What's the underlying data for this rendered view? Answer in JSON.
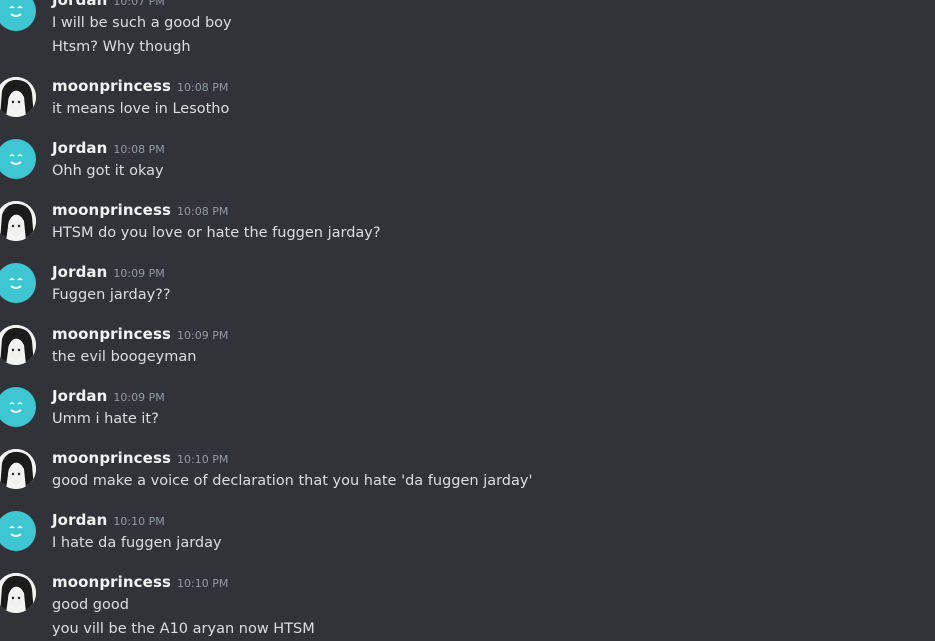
{
  "messages": [
    {
      "author": "Jordan",
      "time": "10:07 PM",
      "avatar": "jordan-avatar-icon",
      "lines": [
        "I will be such a good boy",
        "Htsm? Why though"
      ]
    },
    {
      "author": "moonprincess",
      "time": "10:08 PM",
      "avatar": "moonprincess-avatar-icon",
      "lines": [
        "it means love in Lesotho"
      ]
    },
    {
      "author": "Jordan",
      "time": "10:08 PM",
      "avatar": "jordan-avatar-icon",
      "lines": [
        "Ohh got it okay"
      ]
    },
    {
      "author": "moonprincess",
      "time": "10:08 PM",
      "avatar": "moonprincess-avatar-icon",
      "lines": [
        "HTSM do you love or hate the fuggen jarday?"
      ]
    },
    {
      "author": "Jordan",
      "time": "10:09 PM",
      "avatar": "jordan-avatar-icon",
      "lines": [
        "Fuggen jarday??"
      ]
    },
    {
      "author": "moonprincess",
      "time": "10:09 PM",
      "avatar": "moonprincess-avatar-icon",
      "lines": [
        "the evil boogeyman"
      ]
    },
    {
      "author": "Jordan",
      "time": "10:09 PM",
      "avatar": "jordan-avatar-icon",
      "lines": [
        "Umm i hate it?"
      ]
    },
    {
      "author": "moonprincess",
      "time": "10:10 PM",
      "avatar": "moonprincess-avatar-icon",
      "lines": [
        "good make a voice of declaration that you hate 'da fuggen jarday'"
      ]
    },
    {
      "author": "Jordan",
      "time": "10:10 PM",
      "avatar": "jordan-avatar-icon",
      "lines": [
        "I hate da fuggen jarday"
      ]
    },
    {
      "author": "moonprincess",
      "time": "10:10 PM",
      "avatar": "moonprincess-avatar-icon",
      "lines": [
        "good good",
        "you vill be the A10 aryan now HTSM"
      ]
    }
  ],
  "colors": {
    "background": "#313338",
    "username": "#f2f3f5",
    "timestamp": "#949ba4",
    "text": "#dbdee1",
    "jordan_avatar": "#3ec6d3"
  }
}
